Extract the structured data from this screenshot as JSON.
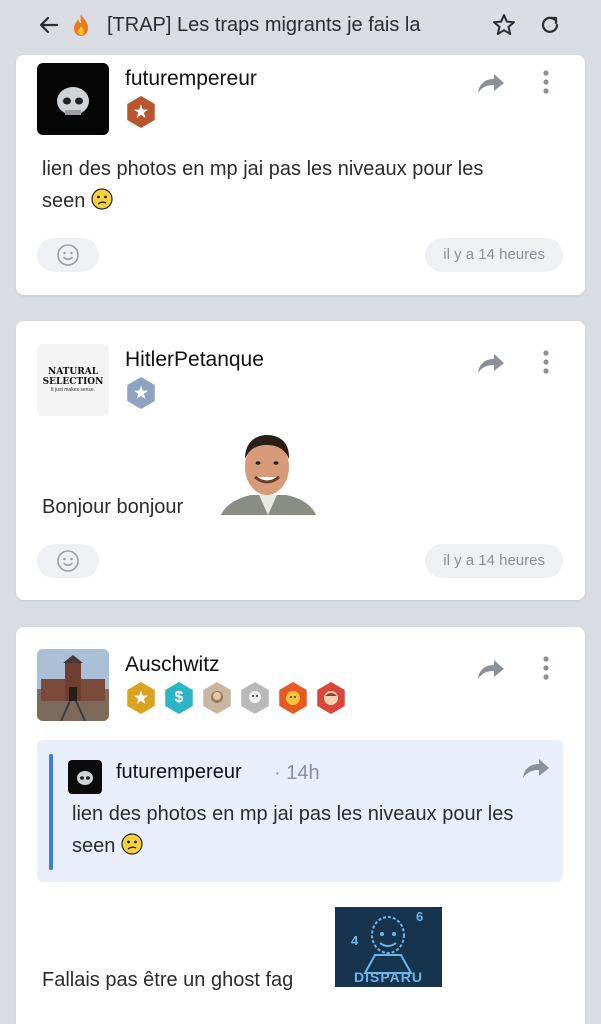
{
  "topbar": {
    "title": "[TRAP] Les traps migrants je fais la",
    "icons": [
      "back-arrow-icon",
      "fire-icon",
      "star-icon",
      "reload-icon"
    ]
  },
  "posts": [
    {
      "username": "futurempereur",
      "badges": [
        "bronze-star-badge"
      ],
      "message": "lien des photos en mp jai pas les niveaux pour les",
      "message_line2": "seen",
      "emoji": "confused-smiley",
      "time": "il y a 14 heures"
    },
    {
      "username": "HitlerPetanque",
      "avatar_text_1": "NATURAL",
      "avatar_text_2": "SELECTION",
      "avatar_text_3": "It just makes sense.",
      "badges": [
        "silver-star-badge"
      ],
      "message": "Bonjour bonjour",
      "sticker": "smiling-man-sticker",
      "time": "il y a 14 heures"
    },
    {
      "username": "Auschwitz",
      "badges": [
        "gold-star-badge",
        "dollar-badge",
        "avatar-badge-1",
        "avatar-badge-2",
        "orange-badge",
        "red-badge"
      ],
      "quote": {
        "username": "futurempereur",
        "separator": "·",
        "time": "14h",
        "text": "lien des photos en mp jai pas les niveaux pour les seen"
      },
      "message": "Fallais pas être un ghost fag",
      "sticker_text": "DISPARU",
      "sticker_num_1": "4",
      "sticker_num_2": "6"
    }
  ],
  "colors": {
    "background": "#d9dce3",
    "card": "#ffffff",
    "quote_bg": "#e8effb",
    "quote_bar": "#3f7fd9",
    "pill": "#eef0f4",
    "muted_text": "#8a8e97"
  }
}
